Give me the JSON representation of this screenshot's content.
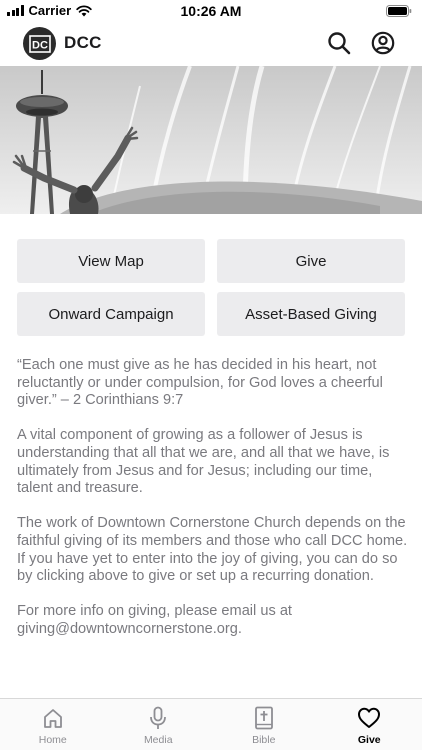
{
  "status_bar": {
    "carrier": "Carrier",
    "time": "10:26 AM"
  },
  "header": {
    "logo_text": "DC",
    "title": "DCC"
  },
  "actions": [
    {
      "label": "View Map"
    },
    {
      "label": "Give"
    },
    {
      "label": "Onward Campaign"
    },
    {
      "label": "Asset-Based Giving"
    }
  ],
  "content": {
    "paragraphs": [
      "“Each one must give as he has decided in his heart, not reluctantly or under compulsion, for God loves a cheerful giver.” – 2 Corinthians 9:7",
      "A vital component of growing as a follower of Jesus is understanding that all that we are, and all that we have, is ultimately from Jesus and for Jesus; including our time, talent and treasure.",
      "The work of Downtown Cornerstone Church depends on the faithful giving of its members and those who call DCC home. If you have yet to enter into the joy of giving, you can do so by clicking above to give or set up a recurring donation.",
      "For more info on giving, please email us at giving@downtowncornerstone.org."
    ]
  },
  "tabs": [
    {
      "label": "Home",
      "icon": "home-icon",
      "active": false
    },
    {
      "label": "Media",
      "icon": "microphone-icon",
      "active": false
    },
    {
      "label": "Bible",
      "icon": "bible-icon",
      "active": false
    },
    {
      "label": "Give",
      "icon": "heart-icon",
      "active": true
    }
  ],
  "colors": {
    "accent": "#000000",
    "button_bg": "#ececee",
    "body_text": "#7a7a7f",
    "inactive_tab": "#8e8e93"
  }
}
